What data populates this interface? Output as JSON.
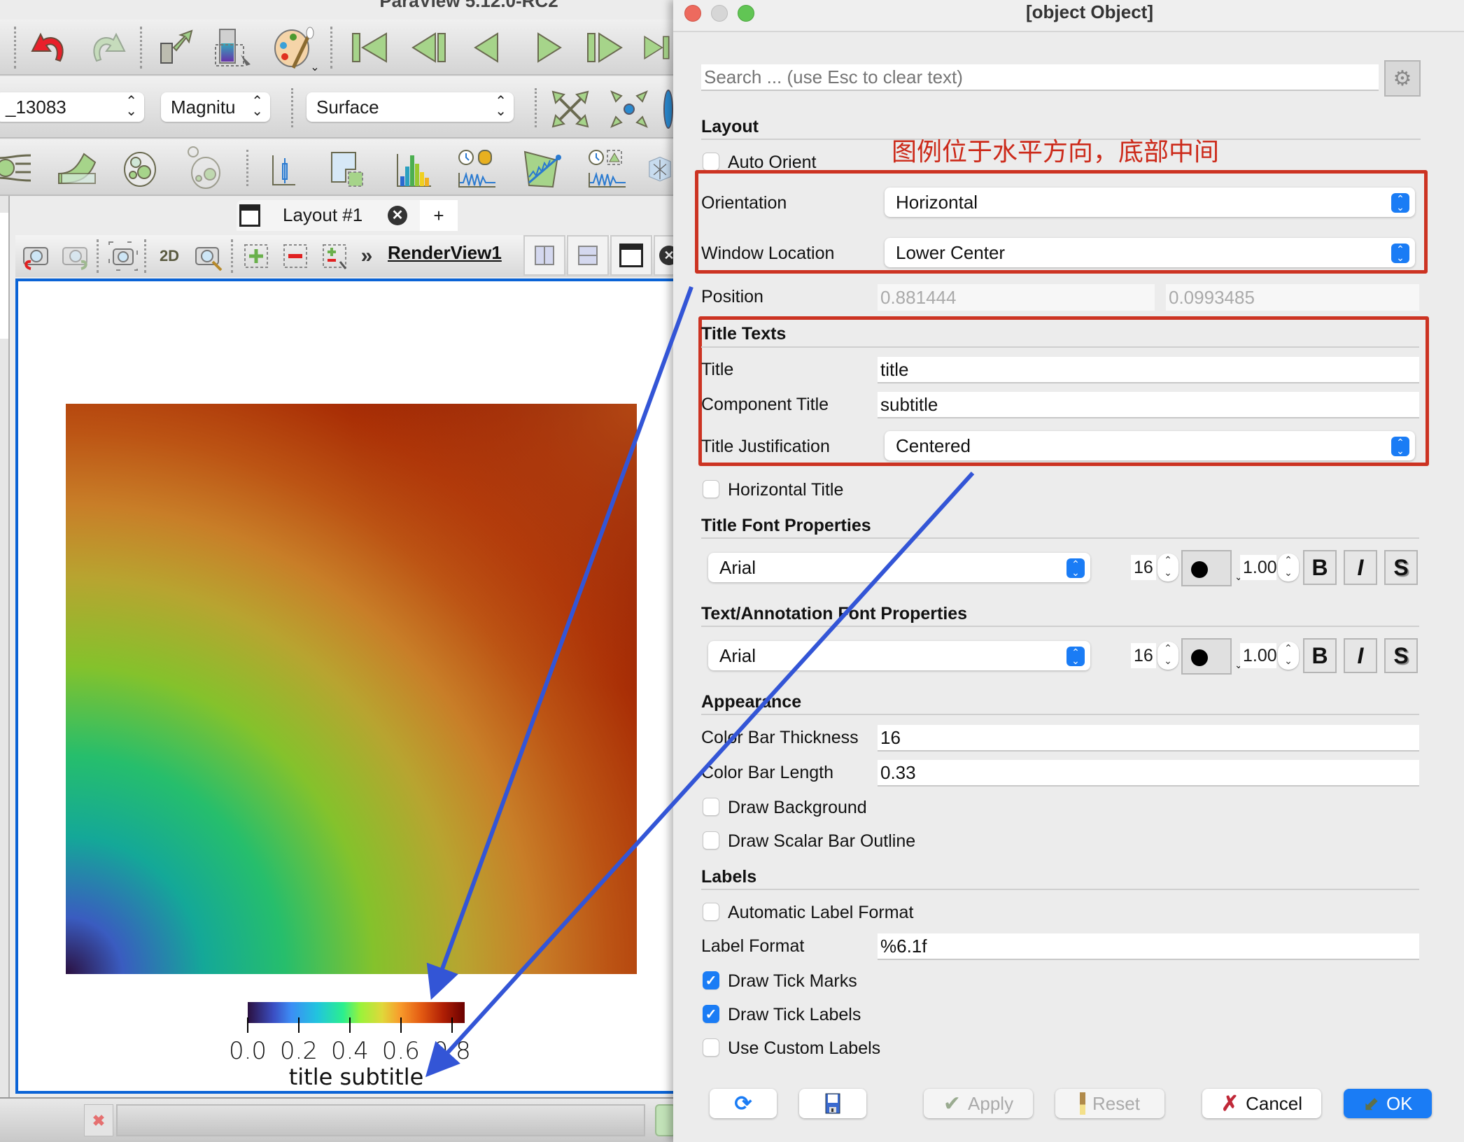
{
  "app": {
    "title": "ParaView 5.12.0-RC2",
    "toolbar": {
      "source_combo": "_13083",
      "component_combo": "Magnitu",
      "representation_combo": "Surface"
    },
    "layout_tab": {
      "label": "Layout #1",
      "add_label": "+"
    },
    "view_toolbar": {
      "mode_2d": "2D",
      "more": "»",
      "view_name": "RenderView1"
    }
  },
  "render": {
    "colorbar": {
      "tick_labels": [
        "0.0",
        "0.2",
        "0.4",
        "0.6",
        "0.8"
      ],
      "title": "title subtitle",
      "range": [
        0.0,
        0.85
      ],
      "colormap": "Turbo"
    }
  },
  "annotations": {
    "note": "图例位于水平方向，底部中间",
    "arrow_color": "#3355d6",
    "box_color": "#cc3322"
  },
  "dialog": {
    "title": {
      "label": "Title",
      "value": "title"
    },
    "search": {
      "placeholder": "Search ... (use Esc to clear text)",
      "value": ""
    },
    "sections": {
      "layout": "Layout",
      "title_texts": "Title Texts",
      "title_font": "Title Font Properties",
      "text_font": "Text/Annotation Font Properties",
      "appearance": "Appearance",
      "labels": "Labels"
    },
    "auto_orient": {
      "label": "Auto Orient",
      "checked": false
    },
    "orientation": {
      "label": "Orientation",
      "value": "Horizontal"
    },
    "window_location": {
      "label": "Window Location",
      "value": "Lower Center"
    },
    "position": {
      "label": "Position",
      "x": "0.881444",
      "y": "0.0993485"
    },
    "component_title": {
      "label": "Component Title",
      "value": "subtitle"
    },
    "title_justification": {
      "label": "Title Justification",
      "value": "Centered"
    },
    "horizontal_title": {
      "label": "Horizontal Title",
      "checked": false
    },
    "title_font": {
      "family": "Arial",
      "size": "16",
      "opacity": "1.00",
      "bold": "B",
      "italic": "I",
      "shadow": "S"
    },
    "text_font": {
      "family": "Arial",
      "size": "16",
      "opacity": "1.00",
      "bold": "B",
      "italic": "I",
      "shadow": "S"
    },
    "color_bar_thickness": {
      "label": "Color Bar Thickness",
      "value": "16"
    },
    "color_bar_length": {
      "label": "Color Bar Length",
      "value": "0.33"
    },
    "draw_background": {
      "label": "Draw Background",
      "checked": false
    },
    "draw_outline": {
      "label": "Draw Scalar Bar Outline",
      "checked": false
    },
    "automatic_label_format": {
      "label": "Automatic Label Format",
      "checked": false
    },
    "label_format": {
      "label": "Label Format",
      "value": "%6.1f"
    },
    "draw_tick_marks": {
      "label": "Draw Tick Marks",
      "checked": true
    },
    "draw_tick_labels": {
      "label": "Draw Tick Labels",
      "checked": true
    },
    "use_custom_labels": {
      "label": "Use Custom Labels",
      "checked": false
    },
    "buttons": {
      "apply": "Apply",
      "reset": "Reset",
      "cancel": "Cancel",
      "ok": "OK"
    }
  }
}
